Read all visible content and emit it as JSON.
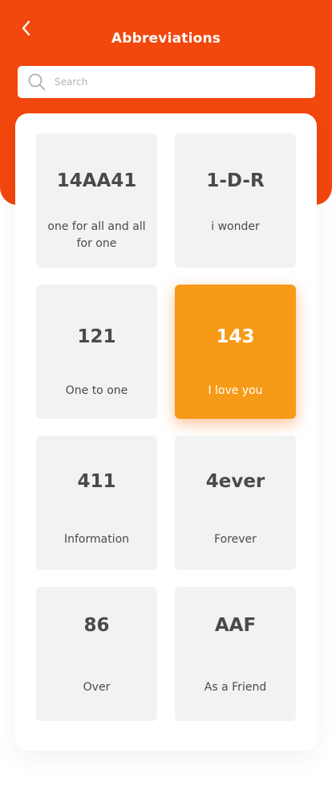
{
  "header": {
    "title": "Abbreviations",
    "back_icon": "chevron-left-icon",
    "background_color": "#f2470d"
  },
  "search": {
    "placeholder": "Search",
    "value": "",
    "icon": "search-icon"
  },
  "cards": [
    {
      "abbr": "14AA41",
      "meaning": "one for all and all for one",
      "active": false
    },
    {
      "abbr": "1-D-R",
      "meaning": "i wonder",
      "active": false
    },
    {
      "abbr": "121",
      "meaning": "One to one",
      "active": false
    },
    {
      "abbr": "143",
      "meaning": "I love you",
      "active": true
    },
    {
      "abbr": "411",
      "meaning": "Information",
      "active": false
    },
    {
      "abbr": "4ever",
      "meaning": "Forever",
      "active": false
    },
    {
      "abbr": "86",
      "meaning": "Over",
      "active": false
    },
    {
      "abbr": "AAF",
      "meaning": "As a Friend",
      "active": false
    }
  ],
  "colors": {
    "accent": "#f79a18",
    "card_bg": "#f2f2f2",
    "text": "#4a4a4a"
  }
}
